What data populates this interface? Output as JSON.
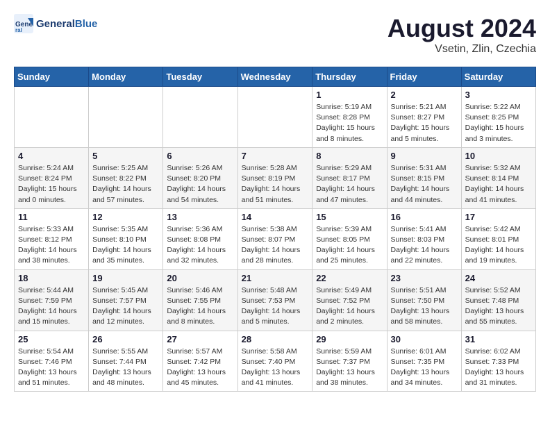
{
  "logo": {
    "text_general": "General",
    "text_blue": "Blue"
  },
  "title": "August 2024",
  "location": "Vsetin, Zlin, Czechia",
  "days_of_week": [
    "Sunday",
    "Monday",
    "Tuesday",
    "Wednesday",
    "Thursday",
    "Friday",
    "Saturday"
  ],
  "weeks": [
    [
      {
        "day": "",
        "info": ""
      },
      {
        "day": "",
        "info": ""
      },
      {
        "day": "",
        "info": ""
      },
      {
        "day": "",
        "info": ""
      },
      {
        "day": "1",
        "info": "Sunrise: 5:19 AM\nSunset: 8:28 PM\nDaylight: 15 hours\nand 8 minutes."
      },
      {
        "day": "2",
        "info": "Sunrise: 5:21 AM\nSunset: 8:27 PM\nDaylight: 15 hours\nand 5 minutes."
      },
      {
        "day": "3",
        "info": "Sunrise: 5:22 AM\nSunset: 8:25 PM\nDaylight: 15 hours\nand 3 minutes."
      }
    ],
    [
      {
        "day": "4",
        "info": "Sunrise: 5:24 AM\nSunset: 8:24 PM\nDaylight: 15 hours\nand 0 minutes."
      },
      {
        "day": "5",
        "info": "Sunrise: 5:25 AM\nSunset: 8:22 PM\nDaylight: 14 hours\nand 57 minutes."
      },
      {
        "day": "6",
        "info": "Sunrise: 5:26 AM\nSunset: 8:20 PM\nDaylight: 14 hours\nand 54 minutes."
      },
      {
        "day": "7",
        "info": "Sunrise: 5:28 AM\nSunset: 8:19 PM\nDaylight: 14 hours\nand 51 minutes."
      },
      {
        "day": "8",
        "info": "Sunrise: 5:29 AM\nSunset: 8:17 PM\nDaylight: 14 hours\nand 47 minutes."
      },
      {
        "day": "9",
        "info": "Sunrise: 5:31 AM\nSunset: 8:15 PM\nDaylight: 14 hours\nand 44 minutes."
      },
      {
        "day": "10",
        "info": "Sunrise: 5:32 AM\nSunset: 8:14 PM\nDaylight: 14 hours\nand 41 minutes."
      }
    ],
    [
      {
        "day": "11",
        "info": "Sunrise: 5:33 AM\nSunset: 8:12 PM\nDaylight: 14 hours\nand 38 minutes."
      },
      {
        "day": "12",
        "info": "Sunrise: 5:35 AM\nSunset: 8:10 PM\nDaylight: 14 hours\nand 35 minutes."
      },
      {
        "day": "13",
        "info": "Sunrise: 5:36 AM\nSunset: 8:08 PM\nDaylight: 14 hours\nand 32 minutes."
      },
      {
        "day": "14",
        "info": "Sunrise: 5:38 AM\nSunset: 8:07 PM\nDaylight: 14 hours\nand 28 minutes."
      },
      {
        "day": "15",
        "info": "Sunrise: 5:39 AM\nSunset: 8:05 PM\nDaylight: 14 hours\nand 25 minutes."
      },
      {
        "day": "16",
        "info": "Sunrise: 5:41 AM\nSunset: 8:03 PM\nDaylight: 14 hours\nand 22 minutes."
      },
      {
        "day": "17",
        "info": "Sunrise: 5:42 AM\nSunset: 8:01 PM\nDaylight: 14 hours\nand 19 minutes."
      }
    ],
    [
      {
        "day": "18",
        "info": "Sunrise: 5:44 AM\nSunset: 7:59 PM\nDaylight: 14 hours\nand 15 minutes."
      },
      {
        "day": "19",
        "info": "Sunrise: 5:45 AM\nSunset: 7:57 PM\nDaylight: 14 hours\nand 12 minutes."
      },
      {
        "day": "20",
        "info": "Sunrise: 5:46 AM\nSunset: 7:55 PM\nDaylight: 14 hours\nand 8 minutes."
      },
      {
        "day": "21",
        "info": "Sunrise: 5:48 AM\nSunset: 7:53 PM\nDaylight: 14 hours\nand 5 minutes."
      },
      {
        "day": "22",
        "info": "Sunrise: 5:49 AM\nSunset: 7:52 PM\nDaylight: 14 hours\nand 2 minutes."
      },
      {
        "day": "23",
        "info": "Sunrise: 5:51 AM\nSunset: 7:50 PM\nDaylight: 13 hours\nand 58 minutes."
      },
      {
        "day": "24",
        "info": "Sunrise: 5:52 AM\nSunset: 7:48 PM\nDaylight: 13 hours\nand 55 minutes."
      }
    ],
    [
      {
        "day": "25",
        "info": "Sunrise: 5:54 AM\nSunset: 7:46 PM\nDaylight: 13 hours\nand 51 minutes."
      },
      {
        "day": "26",
        "info": "Sunrise: 5:55 AM\nSunset: 7:44 PM\nDaylight: 13 hours\nand 48 minutes."
      },
      {
        "day": "27",
        "info": "Sunrise: 5:57 AM\nSunset: 7:42 PM\nDaylight: 13 hours\nand 45 minutes."
      },
      {
        "day": "28",
        "info": "Sunrise: 5:58 AM\nSunset: 7:40 PM\nDaylight: 13 hours\nand 41 minutes."
      },
      {
        "day": "29",
        "info": "Sunrise: 5:59 AM\nSunset: 7:37 PM\nDaylight: 13 hours\nand 38 minutes."
      },
      {
        "day": "30",
        "info": "Sunrise: 6:01 AM\nSunset: 7:35 PM\nDaylight: 13 hours\nand 34 minutes."
      },
      {
        "day": "31",
        "info": "Sunrise: 6:02 AM\nSunset: 7:33 PM\nDaylight: 13 hours\nand 31 minutes."
      }
    ]
  ]
}
